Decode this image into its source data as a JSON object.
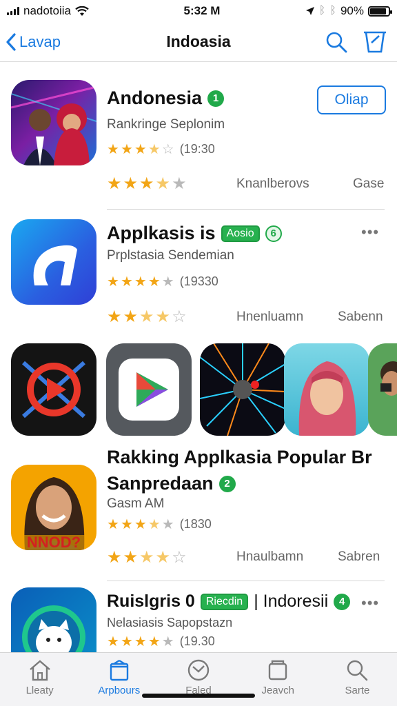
{
  "status_bar": {
    "carrier": "nadotoiia",
    "time": "5:32 M",
    "battery": "90%",
    "battery_level": 0.9
  },
  "nav": {
    "back_label": "Lavap",
    "title": "Indoasia"
  },
  "apps": [
    {
      "name": "Andonesia",
      "rank": "1",
      "subtitle": "Rankringe Seplonim",
      "rating_count": "(19:30",
      "col1": "Knanlberovs",
      "col2": "Gase",
      "button": "Oliap"
    },
    {
      "name": "Applkasis is",
      "tag": "Aosio",
      "rank": "6",
      "subtitle": "Prplstasia Sendemian",
      "rating_count": "(19330",
      "col1": "Hnenluamn",
      "col2": "Sabenn",
      "more": "•••"
    },
    {
      "name": "Sanpredaan",
      "rank": "2",
      "subtitle": "Gasm AM",
      "rating_count": "(1830",
      "col1": "Hnaulbamn",
      "col2": "Sabren",
      "icon_text": "NNOD?"
    },
    {
      "name": "Ruislgris 0",
      "tag": "Riecdin",
      "extra": "| Indoresii",
      "rank": "4",
      "subtitle": "Nelasiasis Sapopstazn",
      "rating_count": "(19.30",
      "more": "•••"
    }
  ],
  "section": {
    "title": "Rakking Applkasia Popular Br"
  },
  "tabs": [
    {
      "label": "Lleaty",
      "icon": "house-icon"
    },
    {
      "label": "Arpbours",
      "icon": "box-icon"
    },
    {
      "label": "Faled",
      "icon": "clock-icon"
    },
    {
      "label": "Jeavch",
      "icon": "stack-icon"
    },
    {
      "label": "Sarte",
      "icon": "search-icon"
    }
  ],
  "colors": {
    "accent": "#1a7ae0",
    "badge_green": "#21a94a",
    "star": "#f2a516"
  }
}
